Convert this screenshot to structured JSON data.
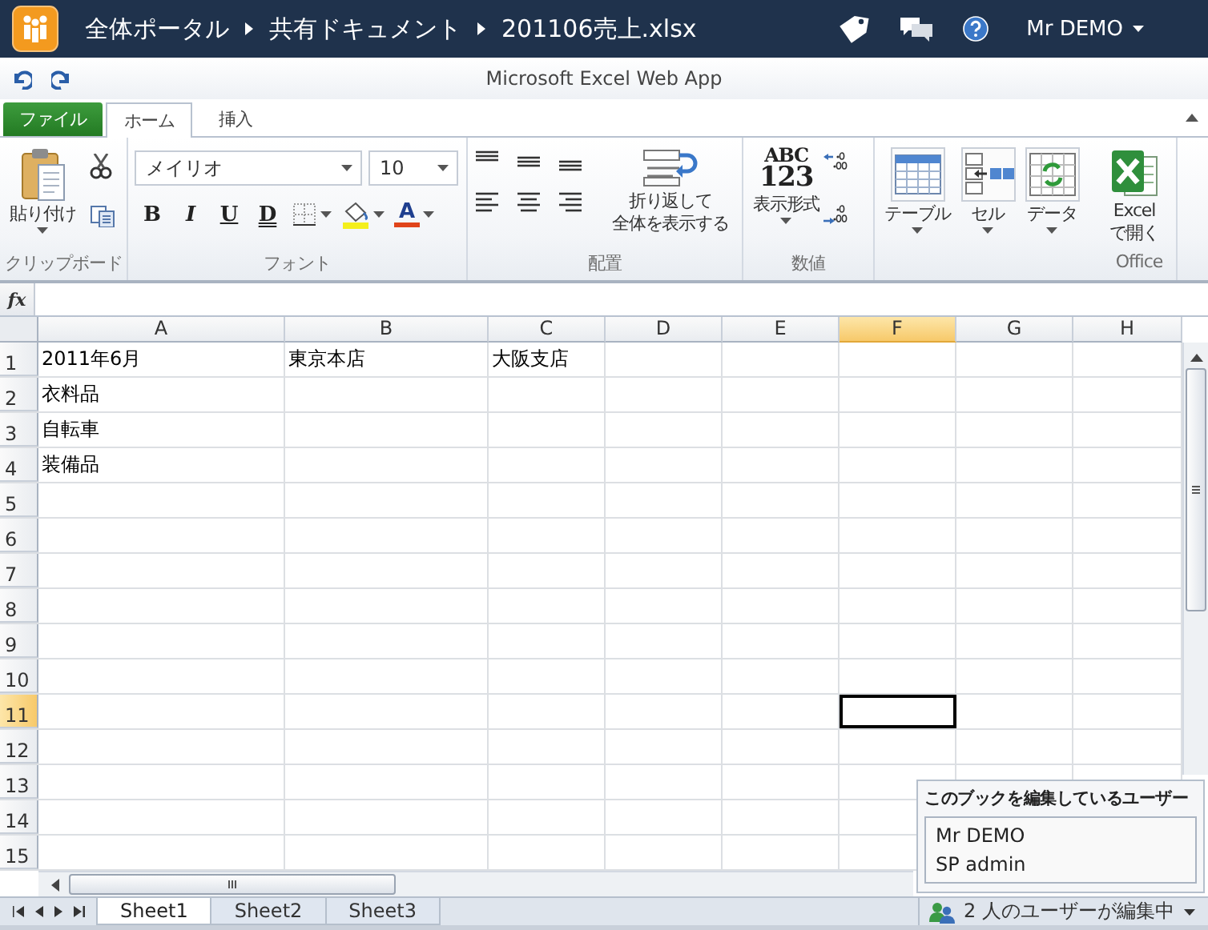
{
  "top_bar": {
    "breadcrumbs": [
      "全体ポータル",
      "共有ドキュメント",
      "201106売上.xlsx"
    ],
    "user": "Mr DEMO"
  },
  "app_title": "Microsoft Excel Web App",
  "tabs": [
    {
      "label": "ファイル",
      "kind": "file",
      "selected": false
    },
    {
      "label": "ホーム",
      "kind": "tab",
      "selected": true
    },
    {
      "label": "挿入",
      "kind": "tab",
      "selected": false
    }
  ],
  "ribbon": {
    "clipboard": {
      "label": "クリップボード",
      "paste": "貼り付け"
    },
    "font": {
      "label": "フォント",
      "font_name": "メイリオ",
      "font_size": "10",
      "style_buttons": [
        {
          "label": "B",
          "kind": "bold"
        },
        {
          "label": "I",
          "kind": "italic"
        },
        {
          "label": "U",
          "kind": "underline"
        },
        {
          "label": "D",
          "kind": "double"
        }
      ],
      "font_color_button": "A"
    },
    "alignment": {
      "label": "配置",
      "wrap_text": [
        "折り返して",
        "全体を表示する"
      ]
    },
    "number": {
      "label": "数値",
      "format_icon": [
        "ABC",
        "123"
      ],
      "format_button": "表示形式"
    },
    "insert": {
      "buttons": [
        "テーブル",
        "セル",
        "データ"
      ]
    },
    "office": {
      "label": "Office",
      "open_button": [
        "Excel",
        "で開く"
      ]
    }
  },
  "formula_bar": {
    "function_label": "fx"
  },
  "sheet": {
    "columns": [
      {
        "label": "A",
        "selected": false
      },
      {
        "label": "B",
        "selected": false
      },
      {
        "label": "C",
        "selected": false
      },
      {
        "label": "D",
        "selected": false
      },
      {
        "label": "E",
        "selected": false
      },
      {
        "label": "F",
        "selected": true
      },
      {
        "label": "G",
        "selected": false
      },
      {
        "label": "H",
        "selected": false
      }
    ],
    "rows": [
      {
        "label": "1",
        "selected": false,
        "cells": [
          "2011年6月",
          "東京本店",
          "大阪支店"
        ]
      },
      {
        "label": "2",
        "selected": false,
        "cells": [
          "衣料品"
        ]
      },
      {
        "label": "3",
        "selected": false,
        "cells": [
          "自転車"
        ]
      },
      {
        "label": "4",
        "selected": false,
        "cells": [
          "装備品"
        ]
      },
      {
        "label": "5",
        "selected": false,
        "cells": []
      },
      {
        "label": "6",
        "selected": false,
        "cells": []
      },
      {
        "label": "7",
        "selected": false,
        "cells": []
      },
      {
        "label": "8",
        "selected": false,
        "cells": []
      },
      {
        "label": "9",
        "selected": false,
        "cells": []
      },
      {
        "label": "10",
        "selected": false,
        "cells": []
      },
      {
        "label": "11",
        "selected": true,
        "cells": []
      },
      {
        "label": "12",
        "selected": false,
        "cells": []
      },
      {
        "label": "13",
        "selected": false,
        "cells": []
      },
      {
        "label": "14",
        "selected": false,
        "cells": []
      },
      {
        "label": "15",
        "selected": false,
        "cells": []
      }
    ]
  },
  "sheet_tabs": [
    {
      "label": "Sheet1",
      "selected": true
    },
    {
      "label": "Sheet2",
      "selected": false
    },
    {
      "label": "Sheet3",
      "selected": false
    }
  ],
  "editors_panel": {
    "title": "このブックを編集しているユーザー",
    "users": [
      "Mr DEMO",
      "SP admin"
    ]
  },
  "status": "2 人のユーザーが編集中"
}
